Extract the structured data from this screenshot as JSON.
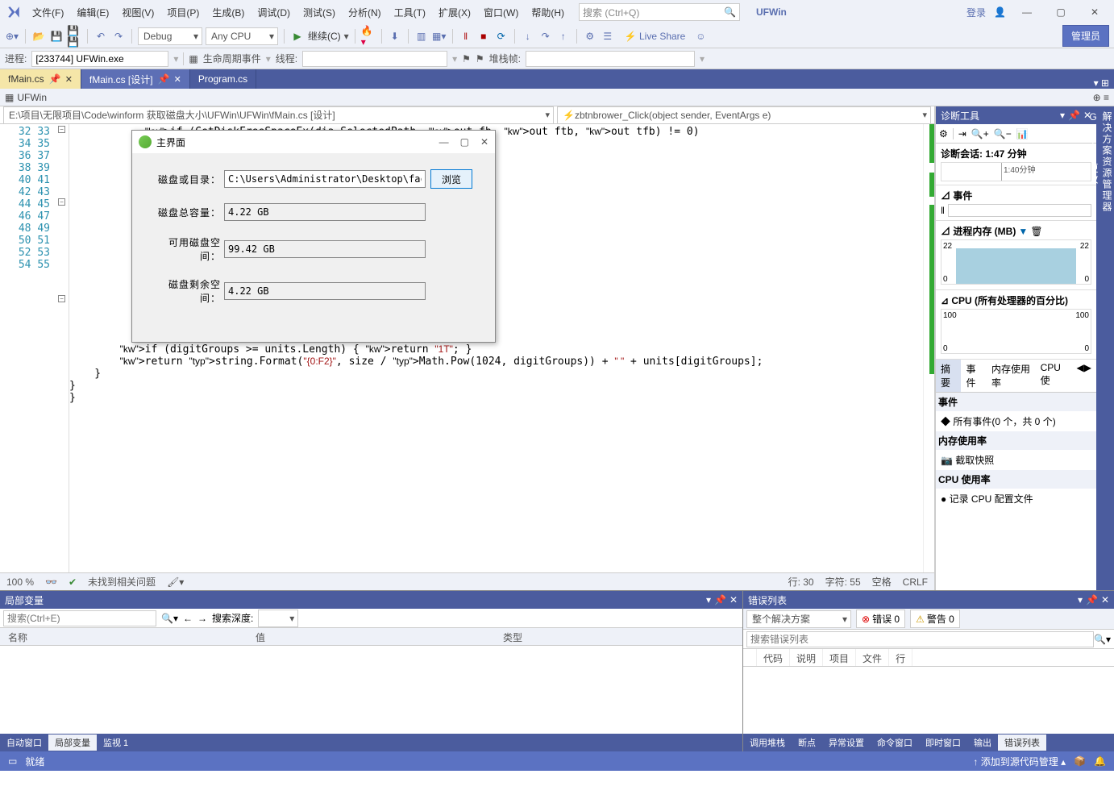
{
  "title_bar": {
    "app_name": "UFWin",
    "login": "登录",
    "search_placeholder": "搜索 (Ctrl+Q)"
  },
  "menu": [
    "文件(F)",
    "编辑(E)",
    "视图(V)",
    "项目(P)",
    "生成(B)",
    "调试(D)",
    "测试(S)",
    "分析(N)",
    "工具(T)",
    "扩展(X)",
    "窗口(W)",
    "帮助(H)"
  ],
  "toolbar": {
    "config": "Debug",
    "platform": "Any CPU",
    "continue": "继续(C)",
    "live_share": "Live Share",
    "admin": "管理员"
  },
  "proc": {
    "label": "进程:",
    "value": "[233744] UFWin.exe",
    "lifecycle": "生命周期事件",
    "thread": "线程:",
    "stack": "堆栈帧:"
  },
  "tabs": [
    {
      "label": "fMain.cs",
      "active": true
    },
    {
      "label": "fMain.cs [设计]",
      "sel": true
    },
    {
      "label": "Program.cs"
    }
  ],
  "crumb": "UFWin",
  "nav": {
    "scope": "E:\\项目\\无限项目\\Code\\winform 获取磁盘大小\\UFWin\\UFWin\\fMain.cs [设计]",
    "member": "zbtnbrower_Click(object sender, EventArgs e)"
  },
  "line_start": 32,
  "line_end": 55,
  "code_lines": [
    "            if (GetDiskFreeSpaceEx(dia.SelectedPath, out fb, out ftb, out tfb) != 0)",
    "",
    "",
    "",
    "",
    "",
    "",
    "",
    "",
    "",
    "",
    "",
    "",
    "",
    "",
    "",
    "",
    "",
    "        if (digitGroups >= units.Length) { return \"1T\"; }",
    "        return string.Format(\"{0:F2}\", size / Math.Pow(1024, digitGroups)) + \" \" + units[digitGroups];",
    "    }",
    "}",
    "}",
    ""
  ],
  "editor_status": {
    "zoom": "100 %",
    "issues": "未找到相关问题",
    "line": "行: 30",
    "col": "字符: 55",
    "space": "空格",
    "eol": "CRLF"
  },
  "dialog": {
    "title": "主界面",
    "path_label": "磁盘或目录：",
    "path_value": "C:\\Users\\Administrator\\Desktop\\faclien",
    "browse": "浏览",
    "total_label": "磁盘总容量：",
    "total_value": "4.22 GB",
    "avail_label": "可用磁盘空间：",
    "avail_value": "99.42 GB",
    "free_label": "磁盘剩余空间：",
    "free_value": "4.22 GB"
  },
  "diag": {
    "title": "诊断工具",
    "session": "诊断会话: 1:47 分钟",
    "timeline_tick": "1:40分钟",
    "events": "事件",
    "mem_title": "进程内存 (MB)",
    "mem_max": "22",
    "cpu_title": "CPU (所有处理器的百分比)",
    "cpu_max": "100",
    "tabs": [
      "摘要",
      "事件",
      "内存使用率",
      "CPU 使"
    ],
    "ev_hdr": "事件",
    "ev_item": "所有事件(0 个，共 0 个)",
    "mem_hdr": "内存使用率",
    "mem_item": "截取快照",
    "cpu_hdr": "CPU 使用率",
    "cpu_item": "记录 CPU 配置文件"
  },
  "rail": [
    "解决方案资源管理器",
    "Git 更改"
  ],
  "locals": {
    "title": "局部变量",
    "search_ph": "搜索(Ctrl+E)",
    "depth": "搜索深度:",
    "cols": [
      "名称",
      "值",
      "类型"
    ],
    "tabs": [
      "自动窗口",
      "局部变量",
      "监视 1"
    ]
  },
  "errors": {
    "title": "错误列表",
    "scope": "整个解决方案",
    "err_btn": "错误 0",
    "warn_btn": "警告 0",
    "search_ph": "搜索错误列表",
    "cols": [
      "",
      "代码",
      "说明",
      "项目",
      "文件",
      "行"
    ],
    "tabs": [
      "调用堆栈",
      "断点",
      "异常设置",
      "命令窗口",
      "即时窗口",
      "输出",
      "错误列表"
    ]
  },
  "status": {
    "ready": "就绪",
    "scm": "添加到源代码管理"
  }
}
